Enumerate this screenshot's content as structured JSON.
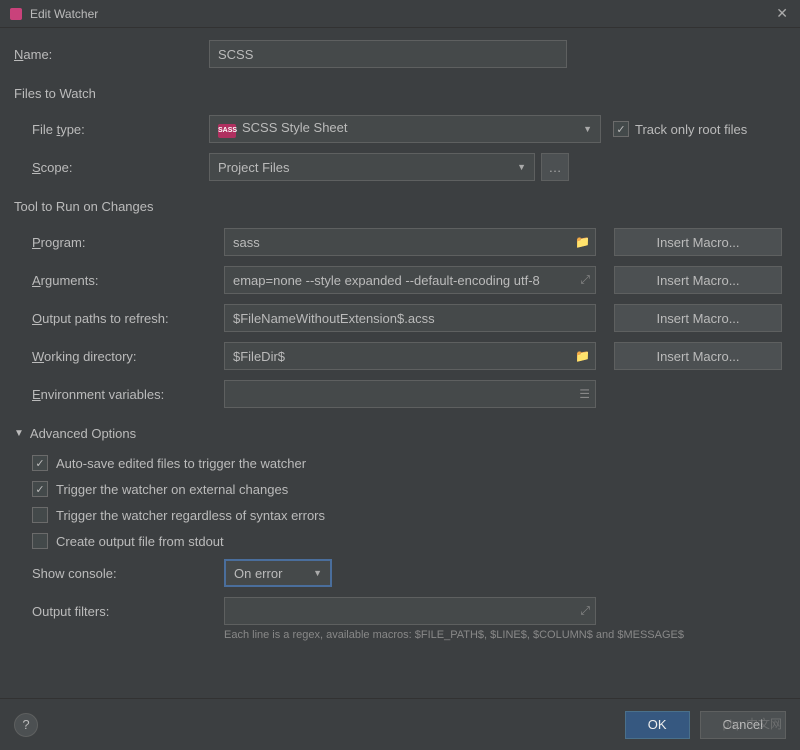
{
  "titlebar": {
    "title": "Edit Watcher"
  },
  "fields": {
    "name_label_pre": "N",
    "name_label_post": "ame:",
    "name_value": "SCSS"
  },
  "sections": {
    "files_to_watch": "Files to Watch",
    "tool_to_run": "Tool to Run on Changes",
    "advanced_options": "Advanced Options"
  },
  "filetype": {
    "label_pre": "File ",
    "label_u": "t",
    "label_post": "ype:",
    "value": "SCSS Style Sheet",
    "track_only_root": "Track only root files",
    "track_checked": true
  },
  "scope": {
    "label_u": "S",
    "label_post": "cope:",
    "value": "Project Files"
  },
  "tool": {
    "program_label_u": "P",
    "program_label_post": "rogram:",
    "program_value": "sass",
    "arguments_label_u": "A",
    "arguments_label_post": "rguments:",
    "arguments_value": "emap=none --style expanded --default-encoding utf-8",
    "output_label_u": "O",
    "output_label_post": "utput paths to refresh:",
    "output_value": "$FileNameWithoutExtension$.acss",
    "working_label_u": "W",
    "working_label_post": "orking directory:",
    "working_value": "$FileDir$",
    "env_label_u": "E",
    "env_label_post": "nvironment variables:",
    "env_value": "",
    "insert_macro": "Insert Macro..."
  },
  "advanced": {
    "auto_save": {
      "label": "Auto-save edited files to trigger the watcher",
      "checked": true
    },
    "trigger_external": {
      "label": "Trigger the watcher on external changes",
      "checked": true
    },
    "regardless_syntax": {
      "label": "Trigger the watcher regardless of syntax errors",
      "checked": false
    },
    "output_stdout": {
      "label": "Create output file from stdout",
      "checked": false
    },
    "show_console_label": "Show console:",
    "show_console_value": "On error",
    "output_filters_label": "Output filters:",
    "output_filters_value": "",
    "hint": "Each line is a regex, available macros: $FILE_PATH$, $LINE$, $COLUMN$ and $MESSAGE$"
  },
  "buttons": {
    "ok": "OK",
    "cancel": "Cancel"
  },
  "watermark": "php 中文网"
}
